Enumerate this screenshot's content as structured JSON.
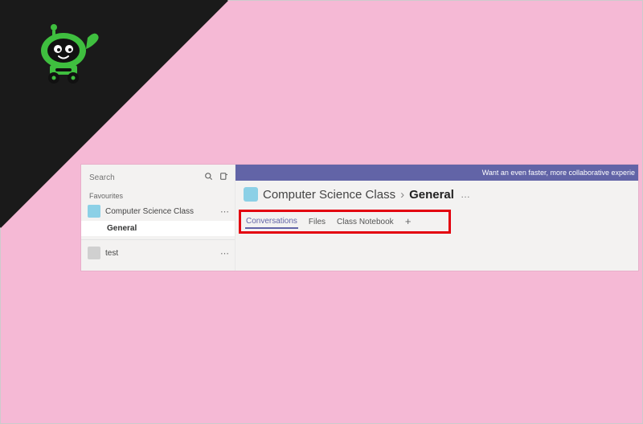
{
  "sidebar": {
    "search_placeholder": "Search",
    "section_label": "Favourites",
    "teams": [
      {
        "name": "Computer Science Class",
        "channels": [
          {
            "name": "General",
            "active": true
          }
        ]
      },
      {
        "name": "test"
      }
    ]
  },
  "banner": {
    "text": "Want an even faster, more collaborative experie"
  },
  "breadcrumb": {
    "team": "Computer Science Class",
    "separator": "›",
    "channel": "General",
    "more": "…"
  },
  "tabs": {
    "items": [
      {
        "label": "Conversations",
        "active": true
      },
      {
        "label": "Files"
      },
      {
        "label": "Class Notebook"
      }
    ],
    "add": "+"
  },
  "colors": {
    "accent": "#6264a7",
    "highlight_box": "#e3000f",
    "page_bg": "#f5b9d5",
    "robot_green": "#3fbf3f"
  }
}
